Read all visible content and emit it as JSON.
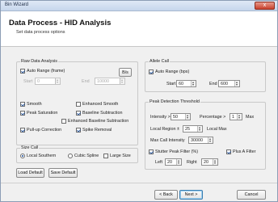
{
  "window": {
    "title": "Bin Wizard",
    "close": "x"
  },
  "header": {
    "title": "Data Process - HID Analysis",
    "subtitle": "Set data process options"
  },
  "raw": {
    "group_label": "Raw Data Analysis",
    "auto_range_label": "Auto Range (frame)",
    "start_label": "Start",
    "start_value": "0",
    "end_label": "End",
    "end_value": "10000",
    "browse_label": "B/s",
    "smooth_label": "Smooth",
    "enhanced_smooth_label": "Enhanced Smooth",
    "peak_saturation_label": "Peak Saturation",
    "baseline_subtraction_label": "Baseline Subtraction",
    "enhanced_baseline_label": "Enhanced Baseline Subtraction",
    "pullup_label": "Pull-up Correction",
    "spike_removal_label": "Spike Removal"
  },
  "size_call": {
    "group_label": "Size Call",
    "local_southern_label": "Local Southern",
    "cubic_spline_label": "Cubic Spline",
    "large_size_label": "Large Size"
  },
  "allele": {
    "group_label": "Allele Call",
    "auto_range_label": "Auto Range (bps)",
    "start_label": "Start",
    "start_value": "60",
    "end_label": "End",
    "end_value": "600"
  },
  "peak": {
    "group_label": "Peak Detection Threshold",
    "intensity_label": "Intensity >",
    "intensity_value": "50",
    "percentage_label": "Percentage >",
    "percentage_value": "1",
    "max_label": "Max",
    "local_region_label": "Local Region ±",
    "local_region_value": "25",
    "local_max_label": "Local Max",
    "maxcall_label": "Max Call Intensity",
    "maxcall_value": "30000",
    "stutter_label": "Stutter Peak Filter (%)",
    "plus_a_label": "Plus A Filter",
    "left_label": "Left",
    "left_value": "20",
    "right_label": "Right",
    "right_value": "20"
  },
  "buttons": {
    "load_default": "Load Default",
    "save_default": "Save Default",
    "back": "< Back",
    "next": "Next >",
    "cancel": "Cancel"
  }
}
